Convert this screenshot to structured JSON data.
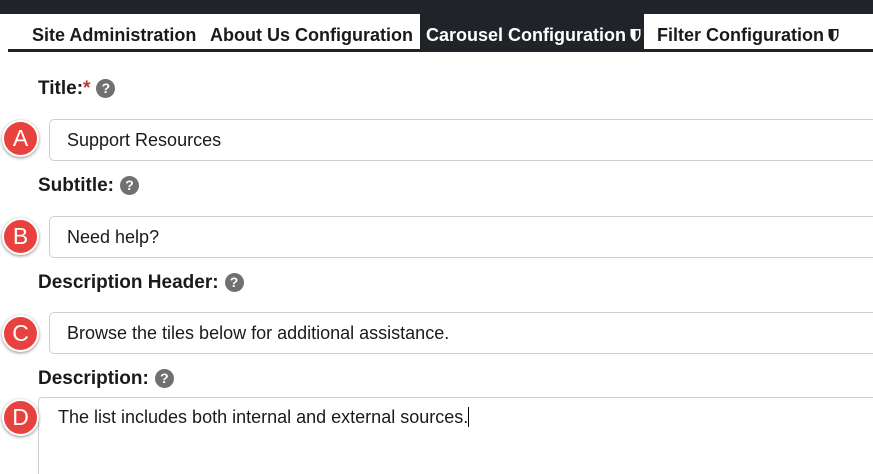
{
  "tabs": [
    {
      "label": "Site Administration",
      "active": false
    },
    {
      "label": "About Us Configuration",
      "active": false
    },
    {
      "label": "Carousel Configuration",
      "active": true,
      "icon": "shield-icon"
    },
    {
      "label": "Filter Configuration",
      "active": false,
      "icon": "shield-icon"
    }
  ],
  "form": {
    "title": {
      "label": "Title:",
      "required_mark": "*",
      "help": "?",
      "value": "Support Resources"
    },
    "subtitle": {
      "label": "Subtitle:",
      "help": "?",
      "value": "Need help?"
    },
    "description_header": {
      "label": "Description Header:",
      "help": "?",
      "value": "Browse the tiles below for additional assistance."
    },
    "description": {
      "label": "Description:",
      "help": "?",
      "value": "The list includes both internal and external sources."
    }
  },
  "annotations": [
    "A",
    "B",
    "C",
    "D"
  ],
  "colors": {
    "header_bg": "#202328",
    "badge": "#e8423f",
    "help_icon": "#707070",
    "required": "#c0392b"
  }
}
